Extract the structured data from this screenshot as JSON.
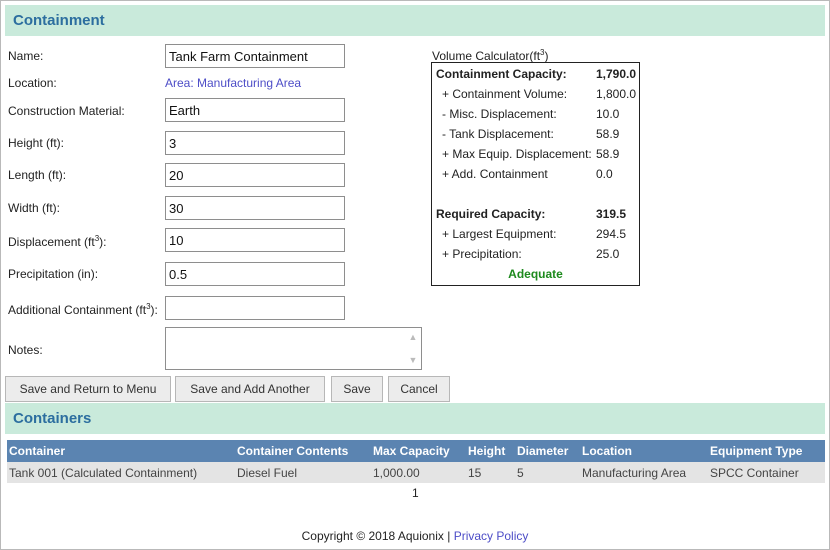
{
  "containment": {
    "section_title": "Containment",
    "fields": {
      "name": {
        "label": "Name:",
        "value": "Tank Farm Containment"
      },
      "location": {
        "label": "Location:",
        "value": "Area: Manufacturing Area"
      },
      "construction_material": {
        "label": "Construction Material:",
        "value": "Earth"
      },
      "height": {
        "label": "Height (ft):",
        "value": "3"
      },
      "length": {
        "label": "Length (ft):",
        "value": "20"
      },
      "width": {
        "label": "Width (ft):",
        "value": "30"
      },
      "displacement": {
        "label_prefix": "Displacement (ft",
        "label_sup": "3",
        "label_suffix": "):",
        "value": "10"
      },
      "precipitation": {
        "label": "Precipitation (in):",
        "value": "0.5"
      },
      "additional": {
        "label_prefix": "Additional Containment (ft",
        "label_sup": "3",
        "label_suffix": "):",
        "value": ""
      },
      "notes": {
        "label": "Notes:",
        "value": ""
      }
    },
    "buttons": {
      "save_return": "Save and Return to Menu",
      "save_add": "Save and Add Another",
      "save": "Save",
      "cancel": "Cancel"
    }
  },
  "calculator": {
    "title_prefix": "Volume Calculator(ft",
    "title_sup": "3",
    "title_suffix": ")",
    "rows": [
      {
        "label": "Containment Capacity:",
        "value": "1,790.0",
        "bold": true
      },
      {
        "label": "+ Containment Volume:",
        "value": "1,800.0"
      },
      {
        "label": "- Misc. Displacement:",
        "value": "10.0"
      },
      {
        "label": "- Tank Displacement:",
        "value": "58.9"
      },
      {
        "label": "+ Max Equip. Displacement:",
        "value": "58.9"
      },
      {
        "label": "+ Add. Containment",
        "value": "0.0"
      },
      {
        "label": "Required Capacity:",
        "value": "319.5",
        "bold": true
      },
      {
        "label": "+ Largest Equipment:",
        "value": "294.5"
      },
      {
        "label": "+ Precipitation:",
        "value": "25.0"
      }
    ],
    "status": "Adequate",
    "status_color": "#1d8a1d"
  },
  "containers": {
    "section_title": "Containers",
    "columns": [
      "Container",
      "Container Contents",
      "Max Capacity",
      "Height",
      "Diameter",
      "Location",
      "Equipment Type"
    ],
    "rows": [
      [
        "Tank 001 (Calculated Containment)",
        "Diesel Fuel",
        "1,000.00",
        "15",
        "5",
        "Manufacturing Area",
        "SPCC Container"
      ]
    ],
    "page": "1"
  },
  "footer": {
    "copyright": "Copyright © 2018 Aquionix |",
    "privacy": "Privacy Policy"
  },
  "colors": {
    "section_bar": "#c9eadb",
    "section_title": "#2c6e9f",
    "table_header": "#5b84b1",
    "link": "#4d4dc7"
  }
}
